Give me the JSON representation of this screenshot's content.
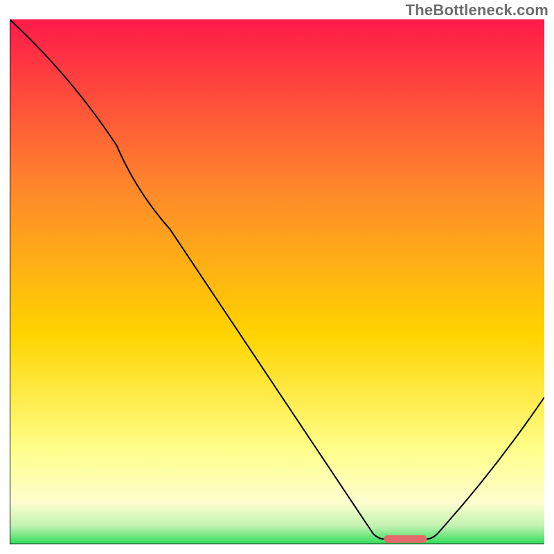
{
  "attribution": "TheBottleneck.com",
  "chart_data": {
    "type": "line",
    "title": "",
    "xlabel": "",
    "ylabel": "",
    "xlim": [
      0,
      100
    ],
    "ylim": [
      0,
      100
    ],
    "grid": false,
    "legend": false,
    "background_gradient": {
      "stops": [
        {
          "offset": 0.0,
          "color": "#ff1a4a"
        },
        {
          "offset": 0.33,
          "color": "#ff8a2a"
        },
        {
          "offset": 0.6,
          "color": "#ffd400"
        },
        {
          "offset": 0.82,
          "color": "#ffff8a"
        },
        {
          "offset": 0.92,
          "color": "#fefecf"
        },
        {
          "offset": 0.965,
          "color": "#c2f2b0"
        },
        {
          "offset": 1.0,
          "color": "#2edc5a"
        }
      ]
    },
    "series": [
      {
        "name": "bottleneck-curve",
        "stroke": "#000000",
        "stroke_width": 2,
        "points": [
          {
            "x": 0,
            "y": 100
          },
          {
            "x": 20,
            "y": 76
          },
          {
            "x": 30,
            "y": 60
          },
          {
            "x": 68,
            "y": 2
          },
          {
            "x": 70,
            "y": 1
          },
          {
            "x": 78,
            "y": 1
          },
          {
            "x": 80,
            "y": 2
          },
          {
            "x": 100,
            "y": 28
          }
        ]
      }
    ],
    "marker": {
      "name": "optimal-range",
      "x_start": 70,
      "x_end": 78,
      "y": 1,
      "color": "#e46a6a"
    }
  }
}
